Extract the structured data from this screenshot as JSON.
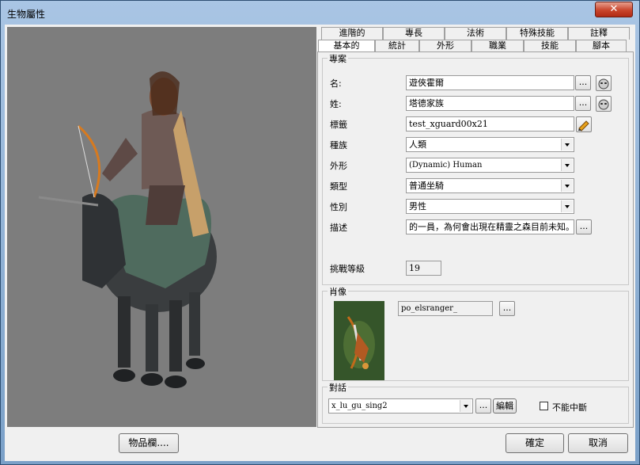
{
  "window": {
    "title": "生物屬性",
    "close_symbol": "✕"
  },
  "tabs": {
    "row1": [
      "進階的",
      "專長",
      "法術",
      "特殊技能",
      "註釋"
    ],
    "row2": [
      "基本的",
      "統計",
      "外形",
      "職業",
      "技能",
      "腳本"
    ],
    "active": "基本的"
  },
  "profile": {
    "group_title": "專案",
    "name": {
      "label": "名:",
      "value": "遊俠霍爾"
    },
    "surname": {
      "label": "姓:",
      "value": "塔德家族"
    },
    "tag": {
      "label": "標籤",
      "value": "test_xguard00x21"
    },
    "race": {
      "label": "種族",
      "value": "人類"
    },
    "appearance": {
      "label": "外形",
      "value": "(Dynamic) Human"
    },
    "type": {
      "label": "類型",
      "value": "普通坐騎"
    },
    "gender": {
      "label": "性別",
      "value": "男性"
    },
    "description": {
      "label": "描述",
      "value": "的一員，為何會出現在精靈之森目前未知。"
    },
    "challenge": {
      "label": "挑戰等級",
      "value": "19"
    },
    "ellipsis": "..."
  },
  "portrait": {
    "group_title": "肖像",
    "value": "po_elsranger_",
    "ellipsis": "..."
  },
  "dialog": {
    "group_title": "對話",
    "value": "x_lu_gu_sing2",
    "ellipsis": "...",
    "edit_label": "編輯",
    "no_interrupt_label": "不能中斷",
    "no_interrupt_checked": false
  },
  "buttons": {
    "inventory": "物品欄....",
    "ok": "確定",
    "cancel": "取消"
  },
  "colors": {
    "titlebar": "#8fb0d6",
    "close": "#c9452c",
    "viewport_bg": "#7d7d7d",
    "dialog_bg": "#f0f0f0"
  },
  "icons": {
    "name_face": "face-mask-icon",
    "surname_face": "face-mask-icon",
    "tag_pen": "pencil-icon"
  }
}
